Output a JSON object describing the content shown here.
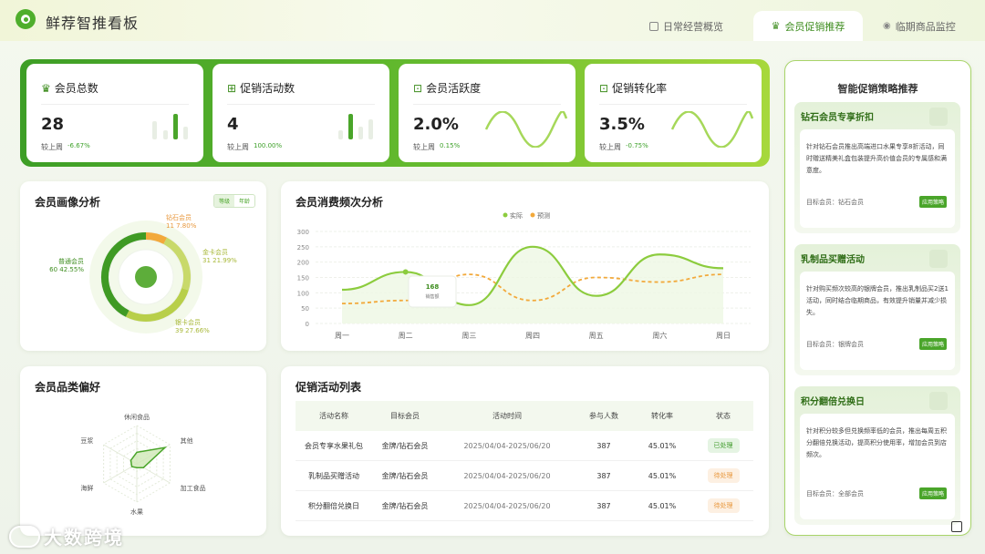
{
  "app": {
    "title": "鲜荐智推看板"
  },
  "tabs": [
    {
      "label": "日常经营概览",
      "icon": "monitor-icon",
      "active": false
    },
    {
      "label": "会员促销推荐",
      "icon": "crown-icon",
      "active": true
    },
    {
      "label": "临期商品监控",
      "icon": "location-icon",
      "active": false
    }
  ],
  "kpis": [
    {
      "title": "会员总数",
      "icon": "crown-icon",
      "value": "28",
      "compare_label": "较上周",
      "change": "-6.67%"
    },
    {
      "title": "促销活动数",
      "icon": "gift-icon",
      "value": "4",
      "compare_label": "较上周",
      "change": "100.00%"
    },
    {
      "title": "会员活跃度",
      "icon": "activity-icon",
      "value": "2.0%",
      "compare_label": "较上周",
      "change": "0.15%"
    },
    {
      "title": "促销转化率",
      "icon": "conversion-icon",
      "value": "3.5%",
      "compare_label": "较上周",
      "change": "-0.75%"
    }
  ],
  "portrait": {
    "title": "会员画像分析",
    "toggle": [
      "等级",
      "年龄"
    ],
    "toggle_active": "等级"
  },
  "frequency": {
    "title": "会员消费频次分析",
    "tooltip_value": "168",
    "tooltip_label": "销售额"
  },
  "category": {
    "title": "会员品类偏好"
  },
  "promo_table": {
    "title": "促销活动列表",
    "columns": [
      "活动名称",
      "目标会员",
      "活动时间",
      "参与人数",
      "转化率",
      "状态"
    ],
    "rows": [
      {
        "name": "会员专享水果礼包",
        "target": "金牌/钻石会员",
        "time": "2025/04/04-2025/06/20",
        "count": "387",
        "rate": "45.01%",
        "status": "已处理",
        "status_type": "done"
      },
      {
        "name": "乳制品买赠活动",
        "target": "金牌/钻石会员",
        "time": "2025/04/04-2025/06/20",
        "count": "387",
        "rate": "45.01%",
        "status": "待处理",
        "status_type": "pending"
      },
      {
        "name": "积分翻倍兑换日",
        "target": "金牌/钻石会员",
        "time": "2025/04/04-2025/06/20",
        "count": "387",
        "rate": "45.01%",
        "status": "待处理",
        "status_type": "pending"
      }
    ]
  },
  "strategy": {
    "title": "智能促销策略推荐",
    "items": [
      {
        "title": "钻石会员专享折扣",
        "desc": "针对钻石会员推出高端进口水果专享8折活动，同时赠送精美礼盒包装提升高价值会员的专属感和满意度。",
        "target": "目标会员：钻石会员",
        "button": "应用策略"
      },
      {
        "title": "乳制品买赠活动",
        "desc": "针对购买频次较高的银牌会员，推出乳制品买2送1活动，同时结合临期商品，有效提升销量并减少损失。",
        "target": "目标会员：银牌会员",
        "button": "应用策略"
      },
      {
        "title": "积分翻倍兑换日",
        "desc": "针对积分较多但兑换频率低的会员，推出每周五积分翻倍兑换活动，提高积分使用率，增加会员到店频次。",
        "target": "目标会员：全部会员",
        "button": "应用策略"
      }
    ]
  },
  "watermark": "大数跨境",
  "colors": {
    "accent": "#4aa52a",
    "dark_green": "#3e8d1f",
    "orange": "#f2a93b",
    "lime": "#c8d96a"
  },
  "chart_data": [
    {
      "type": "pie",
      "title": "会员画像分析",
      "labels": [
        "钻石会员",
        "金卡会员",
        "银卡会员",
        "普通会员"
      ],
      "values": [
        11,
        31,
        39,
        60
      ],
      "percents": [
        "7.80%",
        "21.99%",
        "27.66%",
        "42.55%"
      ],
      "colors": [
        "#f2a93b",
        "#c8d96a",
        "#b8cf4a",
        "#3f9a24"
      ]
    },
    {
      "type": "line",
      "title": "会员消费频次分析",
      "categories": [
        "周一",
        "周二",
        "周三",
        "周四",
        "周五",
        "周六",
        "周日"
      ],
      "series": [
        {
          "name": "实际",
          "values": [
            110,
            168,
            60,
            250,
            90,
            225,
            180
          ],
          "color": "#8ccc3e"
        },
        {
          "name": "预测",
          "values": [
            65,
            75,
            160,
            75,
            150,
            135,
            160
          ],
          "color": "#f2a93b"
        }
      ],
      "ylim": [
        0,
        300
      ],
      "yticks": [
        0,
        50,
        100,
        150,
        200,
        250,
        300
      ],
      "legend": "top-center"
    },
    {
      "type": "radar",
      "title": "会员品类偏好",
      "axes": [
        "休闲食品",
        "其他",
        "加工食品",
        "水果",
        "海鲜",
        "豆浆"
      ],
      "values": [
        30,
        85,
        20,
        10,
        15,
        18
      ],
      "max": 100
    }
  ]
}
